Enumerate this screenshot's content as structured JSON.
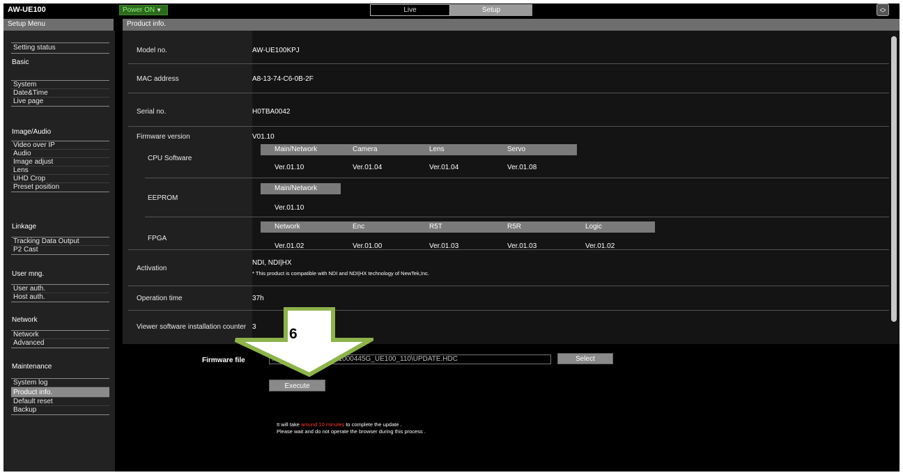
{
  "app": {
    "title": "AW-UE100",
    "power_label": "Power ON"
  },
  "tabs": {
    "live": "Live",
    "setup": "Setup"
  },
  "sidebar": {
    "header": "Setup Menu",
    "status": "Setting status",
    "groups": [
      {
        "title": "Basic",
        "items": [
          "System",
          "Date&Time",
          "Live page"
        ]
      },
      {
        "title": "Image/Audio",
        "items": [
          "Video over IP",
          "Audio",
          "Image adjust",
          "Lens",
          "UHD Crop",
          "Preset position"
        ]
      },
      {
        "title": "Linkage",
        "items": [
          "Tracking Data Output",
          "P2 Cast"
        ]
      },
      {
        "title": "User mng.",
        "items": [
          "User auth.",
          "Host auth."
        ]
      },
      {
        "title": "Network",
        "items": [
          "Network",
          "Advanced"
        ]
      },
      {
        "title": "Maintenance",
        "items": [
          "System log",
          "Product info.",
          "Default reset",
          "Backup"
        ]
      }
    ],
    "active_item": "Product info."
  },
  "product": {
    "header": "Product info.",
    "model_label": "Model no.",
    "model_value": "AW-UE100KPJ",
    "mac_label": "MAC address",
    "mac_value": "A8-13-74-C6-0B-2F",
    "serial_label": "Serial no.",
    "serial_value": "H0TBA0042",
    "firmware_label": "Firmware version",
    "firmware_value": "V01.10",
    "cpu": {
      "label": "CPU Software",
      "headers": [
        "Main/Network",
        "Camera",
        "Lens",
        "Servo"
      ],
      "values": [
        "Ver.01.10",
        "Ver.01.04",
        "Ver.01.04",
        "Ver.01.08"
      ]
    },
    "eeprom": {
      "label": "EEPROM",
      "headers": [
        "Main/Network"
      ],
      "values": [
        "Ver.01.10"
      ]
    },
    "fpga": {
      "label": "FPGA",
      "headers": [
        "Network",
        "Enc",
        "R5T",
        "R5R",
        "Logic"
      ],
      "values": [
        "Ver.01.02",
        "Ver.01.00",
        "Ver.01.03",
        "Ver.01.03",
        "Ver.01.02"
      ]
    },
    "activation_label": "Activation",
    "activation_value": "NDI, NDI|HX",
    "activation_note": "* This product is compatible with NDI and NDI|HX technology of NewTek,Inc.",
    "operation_label": "Operation time",
    "operation_value": "37h",
    "viewer_label": "Viewer software installation counter",
    "viewer_value": "3"
  },
  "update": {
    "firmware_file_label": "Firmware file",
    "firmware_file_value": "…04\\Downloads\\DV91000445G_UE100_110\\UPDATE.HDC",
    "select_label": "Select",
    "execute_label": "Execute",
    "msg_prefix": "It will take ",
    "msg_highlight": "around 10 minutes",
    "msg_suffix": " to complete the update .",
    "msg_line2": "Please wait and do not operate the browser during this process ."
  },
  "callout": {
    "number": "6",
    "color": "#8db34a"
  },
  "icons": {
    "scroll_toggle": "up-down-chevron-icon",
    "power_caret": "caret-down-icon"
  }
}
